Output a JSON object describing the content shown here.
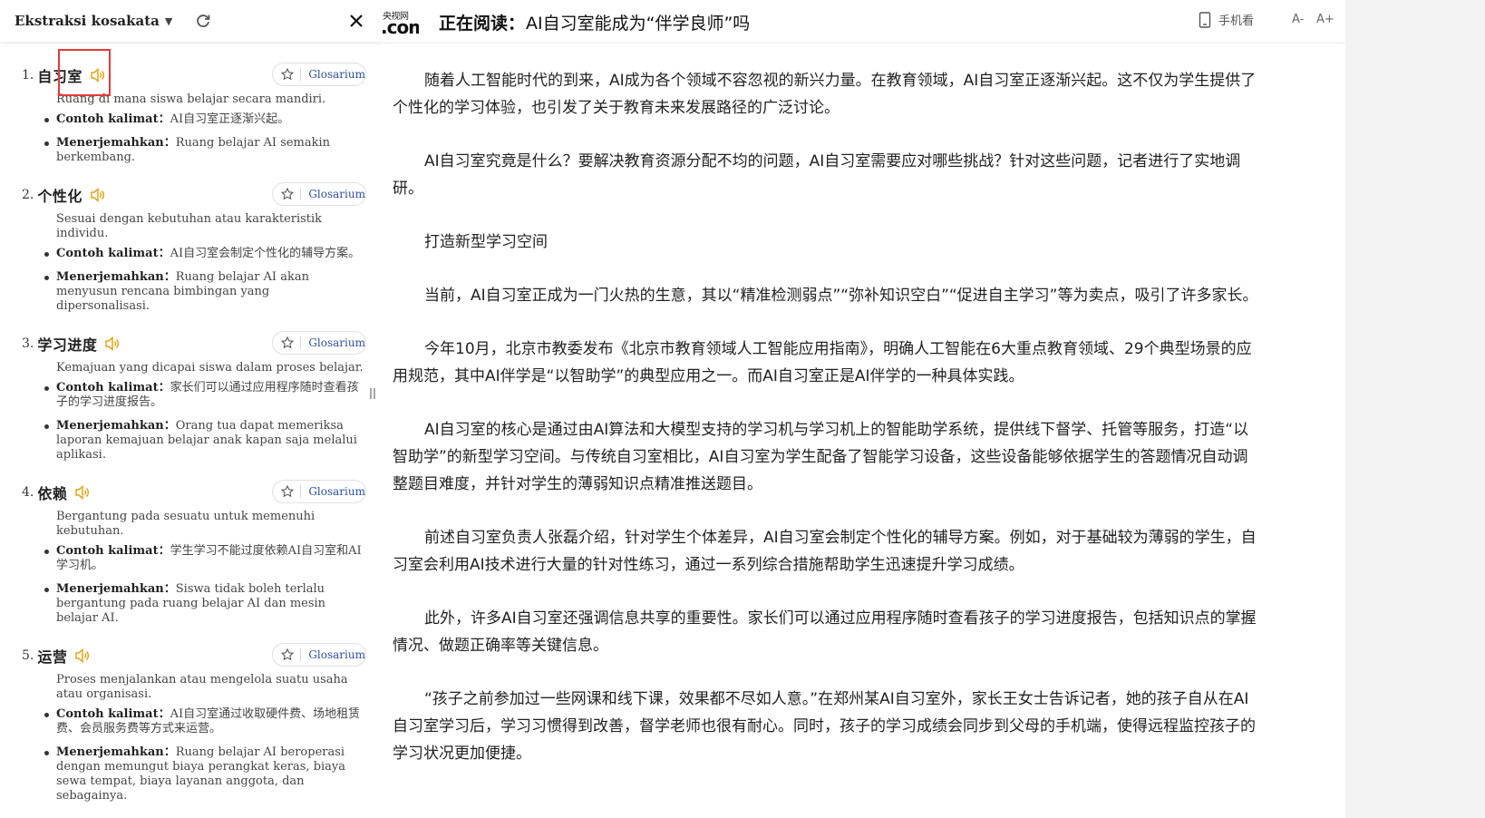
{
  "panel": {
    "title": "Ekstraksi kosakata",
    "glossary_label": "Glosarium",
    "entries": [
      {
        "num": "1.",
        "word": "自习室",
        "definition": "Ruang di mana siswa belajar secara mandiri.",
        "example_label": "Contoh kalimat",
        "example": "AI自习室正逐渐兴起。",
        "translate_label": "Menerjemahkan",
        "translation": "Ruang belajar AI semakin berkembang."
      },
      {
        "num": "2.",
        "word": "个性化",
        "definition": "Sesuai dengan kebutuhan atau karakteristik individu.",
        "example_label": "Contoh kalimat",
        "example": "AI自习室会制定个性化的辅导方案。",
        "translate_label": "Menerjemahkan",
        "translation": "Ruang belajar AI akan menyusun rencana bimbingan yang dipersonalisasi."
      },
      {
        "num": "3.",
        "word": "学习进度",
        "definition": "Kemajuan yang dicapai siswa dalam proses belajar.",
        "example_label": "Contoh kalimat",
        "example": "家长们可以通过应用程序随时查看孩子的学习进度报告。",
        "translate_label": "Menerjemahkan",
        "translation": "Orang tua dapat memeriksa laporan kemajuan belajar anak kapan saja melalui aplikasi."
      },
      {
        "num": "4.",
        "word": "依赖",
        "definition": "Bergantung pada sesuatu untuk memenuhi kebutuhan.",
        "example_label": "Contoh kalimat",
        "example": "学生学习不能过度依赖AI自习室和AI学习机。",
        "translate_label": "Menerjemahkan",
        "translation": "Siswa tidak boleh terlalu bergantung pada ruang belajar AI dan mesin belajar AI."
      },
      {
        "num": "5.",
        "word": "运营",
        "definition": "Proses menjalankan atau mengelola suatu usaha atau organisasi.",
        "example_label": "Contoh kalimat",
        "example": "AI自习室通过收取硬件费、场地租赁费、会员服务费等方式来运营。",
        "translate_label": "Menerjemahkan",
        "translation": "Ruang belajar AI beroperasi dengan memungut biaya perangkat keras, biaya sewa tempat, biaya layanan anggota, dan sebagainya."
      }
    ]
  },
  "reader": {
    "logo_small": "央视网",
    "logo_big": ".com",
    "reading_label": "正在阅读：",
    "reading_title": "AI自习室能成为“伴学良师”吗",
    "phone_view_label": "手机看",
    "font_smaller": "A-",
    "font_larger": "A+",
    "paragraphs": [
      "随着人工智能时代的到来，AI成为各个领域不容忽视的新兴力量。在教育领域，AI自习室正逐渐兴起。这不仅为学生提供了个性化的学习体验，也引发了关于教育未来发展路径的广泛讨论。",
      "AI自习室究竟是什么？要解决教育资源分配不均的问题，AI自习室需要应对哪些挑战？针对这些问题，记者进行了实地调研。",
      "打造新型学习空间",
      "当前，AI自习室正成为一门火热的生意，其以“精准检测弱点”“弥补知识空白”“促进自主学习”等为卖点，吸引了许多家长。",
      "今年10月，北京市教委发布《北京市教育领域人工智能应用指南》，明确人工智能在6大重点教育领域、29个典型场景的应用规范，其中AI伴学是“以智助学”的典型应用之一。而AI自习室正是AI伴学的一种具体实践。",
      "AI自习室的核心是通过由AI算法和大模型支持的学习机与学习机上的智能助学系统，提供线下督学、托管等服务，打造“以智助学”的新型学习空间。与传统自习室相比，AI自习室为学生配备了智能学习设备，这些设备能够依据学生的答题情况自动调整题目难度，并针对学生的薄弱知识点精准推送题目。",
      "前述自习室负责人张磊介绍，针对学生个体差异，AI自习室会制定个性化的辅导方案。例如，对于基础较为薄弱的学生，自习室会利用AI技术进行大量的针对性练习，通过一系列综合措施帮助学生迅速提升学习成绩。",
      "此外，许多AI自习室还强调信息共享的重要性。家长们可以通过应用程序随时查看孩子的学习进度报告，包括知识点的掌握情况、做题正确率等关键信息。",
      "“孩子之前参加过一些网课和线下课，效果都不尽如人意。”在郑州某AI自习室外，家长王女士告诉记者，她的孩子自从在AI自习室学习后，学习习惯得到改善，督学老师也很有耐心。同时，孩子的学习成绩会同步到父母的手机端，使得远程监控孩子的学习状况更加便捷。"
    ]
  },
  "colors": {
    "accent_speaker": "#e8a317",
    "glossary_text": "#2e4fa8",
    "highlight": "#e53935"
  }
}
